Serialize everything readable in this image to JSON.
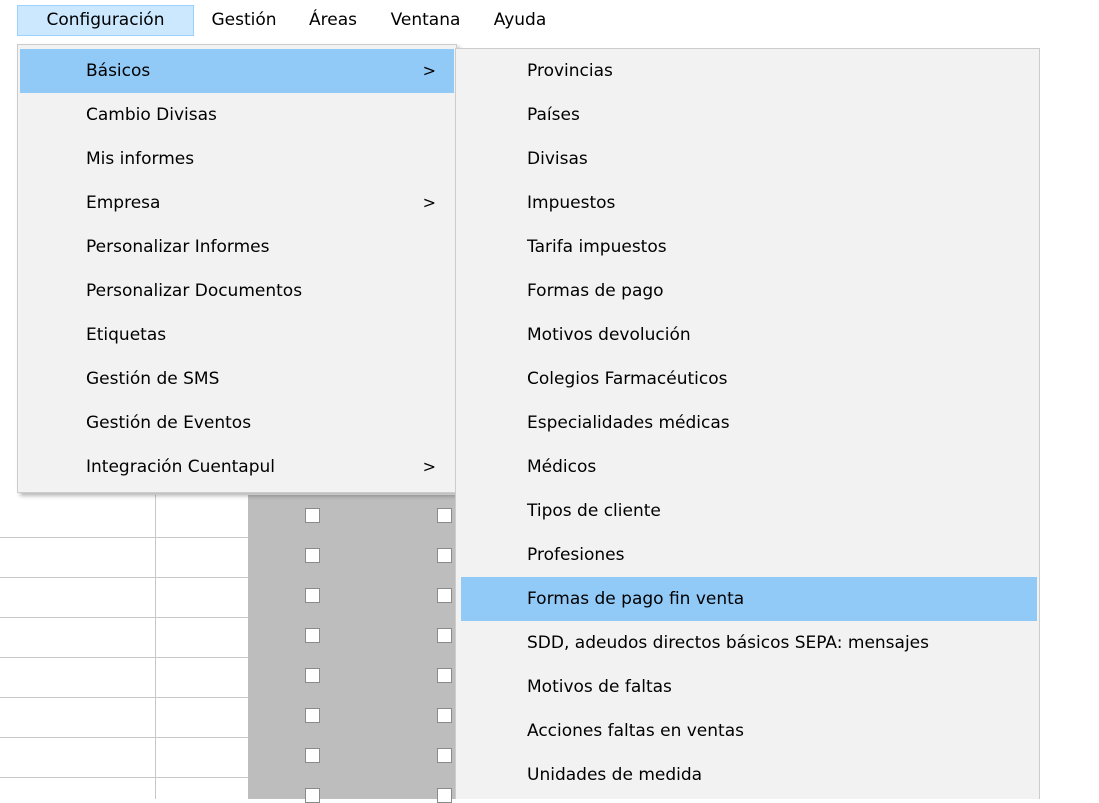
{
  "menubar": {
    "items": [
      {
        "label": "Configuración"
      },
      {
        "label": "Gestión"
      },
      {
        "label": "Áreas"
      },
      {
        "label": "Ventana"
      },
      {
        "label": "Ayuda"
      }
    ]
  },
  "config_menu": {
    "items": [
      {
        "label": "Básicos",
        "submenu_arrow": ">"
      },
      {
        "label": "Cambio Divisas"
      },
      {
        "label": "Mis informes"
      },
      {
        "label": "Empresa",
        "submenu_arrow": ">"
      },
      {
        "label": "Personalizar Informes"
      },
      {
        "label": "Personalizar Documentos"
      },
      {
        "label": "Etiquetas"
      },
      {
        "label": "Gestión de SMS"
      },
      {
        "label": "Gestión de Eventos"
      },
      {
        "label": "Integración Cuentapul",
        "submenu_arrow": ">"
      }
    ]
  },
  "basicos_menu": {
    "items": [
      {
        "label": "Provincias"
      },
      {
        "label": "Países"
      },
      {
        "label": "Divisas"
      },
      {
        "label": "Impuestos"
      },
      {
        "label": "Tarifa impuestos"
      },
      {
        "label": "Formas de pago"
      },
      {
        "label": "Motivos devolución"
      },
      {
        "label": "Colegios Farmacéuticos"
      },
      {
        "label": "Especialidades médicas"
      },
      {
        "label": "Médicos"
      },
      {
        "label": "Tipos de cliente"
      },
      {
        "label": "Profesiones"
      },
      {
        "label": "Formas de pago fin venta"
      },
      {
        "label": "SDD, adeudos directos básicos SEPA: mensajes"
      },
      {
        "label": "Motivos de faltas"
      },
      {
        "label": "Acciones faltas en ventas"
      },
      {
        "label": "Unidades de medida"
      }
    ]
  },
  "colors": {
    "menu_background": "#f2f2f2",
    "highlight": "#91c9f7",
    "menubar_open": "#cce8ff"
  }
}
